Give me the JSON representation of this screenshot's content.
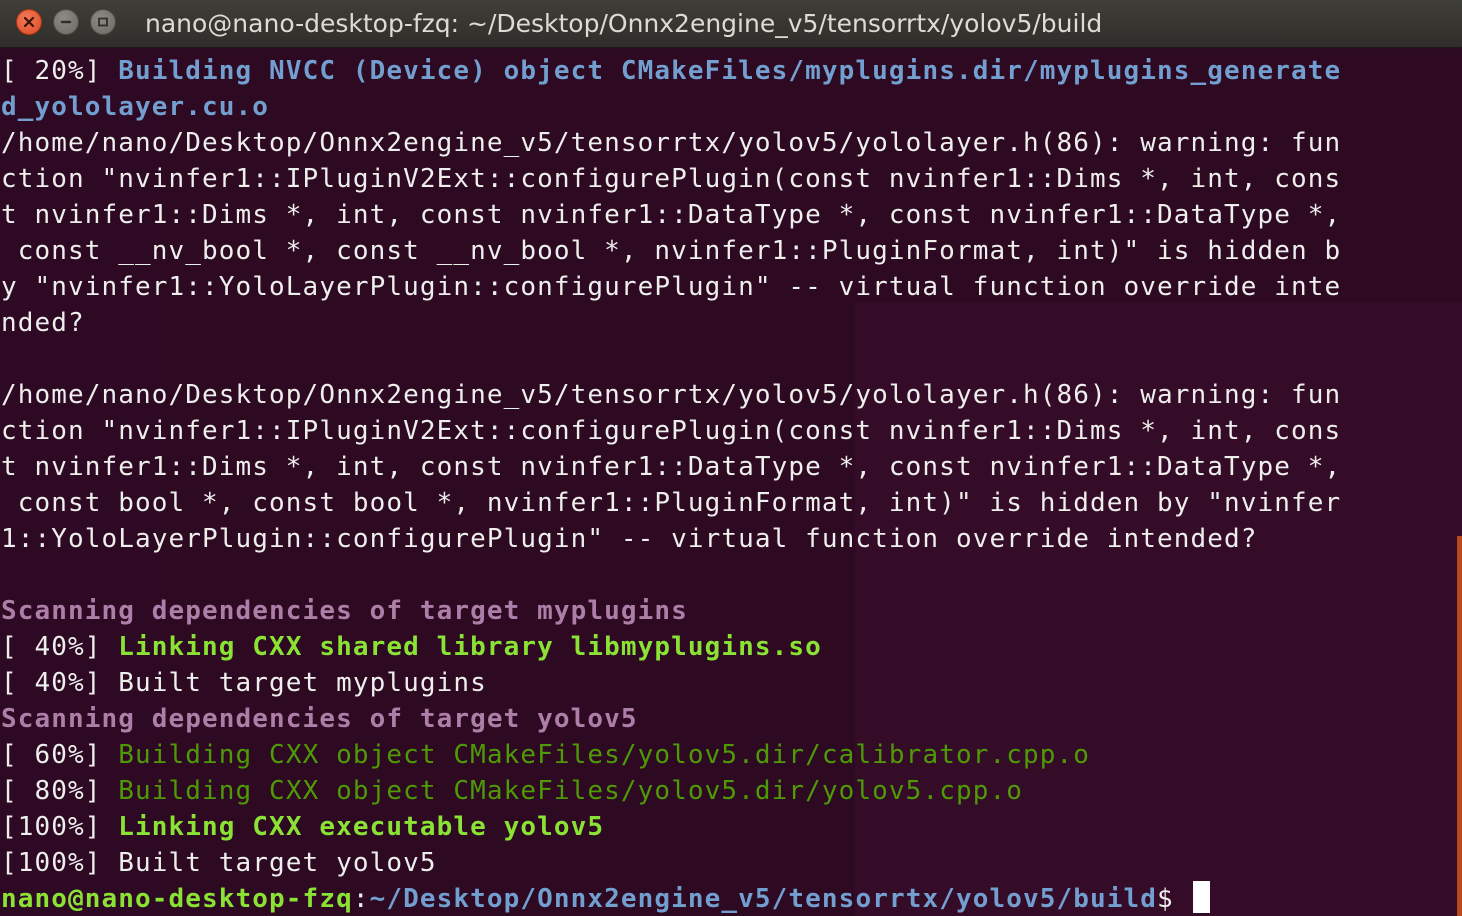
{
  "window": {
    "title": "nano@nano-desktop-fzq: ~/Desktop/Onnx2engine_v5/tensorrtx/yolov5/build",
    "close_icon": "close-icon",
    "minimize_icon": "minimize-icon",
    "maximize_icon": "maximize-icon"
  },
  "colors": {
    "background": "#2d0922",
    "text": "#eeeeec",
    "blue": "#729fcf",
    "magenta": "#ad7fa8",
    "green_bold": "#8ae234",
    "green": "#4e9a06",
    "close_button": "#e95420"
  },
  "terminal": {
    "lines": [
      {
        "parts": [
          {
            "t": "[ 20%] ",
            "s": ""
          },
          {
            "t": "Building NVCC (Device) object CMakeFiles/myplugins.dir/myplugins_generate",
            "s": "c-blue"
          }
        ]
      },
      {
        "parts": [
          {
            "t": "d_yololayer.cu.o",
            "s": "c-blue"
          }
        ]
      },
      {
        "parts": [
          {
            "t": "/home/nano/Desktop/Onnx2engine_v5/tensorrtx/yolov5/yololayer.h(86): warning: fun",
            "s": ""
          }
        ]
      },
      {
        "parts": [
          {
            "t": "ction \"nvinfer1::IPluginV2Ext::configurePlugin(const nvinfer1::Dims *, int, cons",
            "s": ""
          }
        ]
      },
      {
        "parts": [
          {
            "t": "t nvinfer1::Dims *, int, const nvinfer1::DataType *, const nvinfer1::DataType *,",
            "s": ""
          }
        ]
      },
      {
        "parts": [
          {
            "t": " const __nv_bool *, const __nv_bool *, nvinfer1::PluginFormat, int)\" is hidden b",
            "s": ""
          }
        ]
      },
      {
        "parts": [
          {
            "t": "y \"nvinfer1::YoloLayerPlugin::configurePlugin\" -- virtual function override inte",
            "s": ""
          }
        ]
      },
      {
        "parts": [
          {
            "t": "nded?",
            "s": ""
          }
        ]
      },
      {
        "parts": [
          {
            "t": "",
            "s": ""
          }
        ]
      },
      {
        "parts": [
          {
            "t": "/home/nano/Desktop/Onnx2engine_v5/tensorrtx/yolov5/yololayer.h(86): warning: fun",
            "s": ""
          }
        ]
      },
      {
        "parts": [
          {
            "t": "ction \"nvinfer1::IPluginV2Ext::configurePlugin(const nvinfer1::Dims *, int, cons",
            "s": ""
          }
        ]
      },
      {
        "parts": [
          {
            "t": "t nvinfer1::Dims *, int, const nvinfer1::DataType *, const nvinfer1::DataType *,",
            "s": ""
          }
        ]
      },
      {
        "parts": [
          {
            "t": " const bool *, const bool *, nvinfer1::PluginFormat, int)\" is hidden by \"nvinfer",
            "s": ""
          }
        ]
      },
      {
        "parts": [
          {
            "t": "1::YoloLayerPlugin::configurePlugin\" -- virtual function override intended?",
            "s": ""
          }
        ]
      },
      {
        "parts": [
          {
            "t": "",
            "s": ""
          }
        ]
      },
      {
        "parts": [
          {
            "t": "Scanning dependencies of target myplugins",
            "s": "c-magenta"
          }
        ]
      },
      {
        "parts": [
          {
            "t": "[ 40%] ",
            "s": ""
          },
          {
            "t": "Linking CXX shared library libmyplugins.so",
            "s": "c-green-b"
          }
        ]
      },
      {
        "parts": [
          {
            "t": "[ 40%] Built target myplugins",
            "s": ""
          }
        ]
      },
      {
        "parts": [
          {
            "t": "Scanning dependencies of target yolov5",
            "s": "c-magenta"
          }
        ]
      },
      {
        "parts": [
          {
            "t": "[ 60%] ",
            "s": ""
          },
          {
            "t": "Building CXX object CMakeFiles/yolov5.dir/calibrator.cpp.o",
            "s": "c-green"
          }
        ]
      },
      {
        "parts": [
          {
            "t": "[ 80%] ",
            "s": ""
          },
          {
            "t": "Building CXX object CMakeFiles/yolov5.dir/yolov5.cpp.o",
            "s": "c-green"
          }
        ]
      },
      {
        "parts": [
          {
            "t": "[100%] ",
            "s": ""
          },
          {
            "t": "Linking CXX executable yolov5",
            "s": "c-green-b"
          }
        ]
      },
      {
        "parts": [
          {
            "t": "[100%] Built target yolov5",
            "s": ""
          }
        ]
      }
    ],
    "prompt": {
      "user_host": "nano@nano-desktop-fzq",
      "separator": ":",
      "path": "~/Desktop/Onnx2engine_v5/tensorrtx/yolov5/build",
      "symbol": "$ "
    }
  }
}
